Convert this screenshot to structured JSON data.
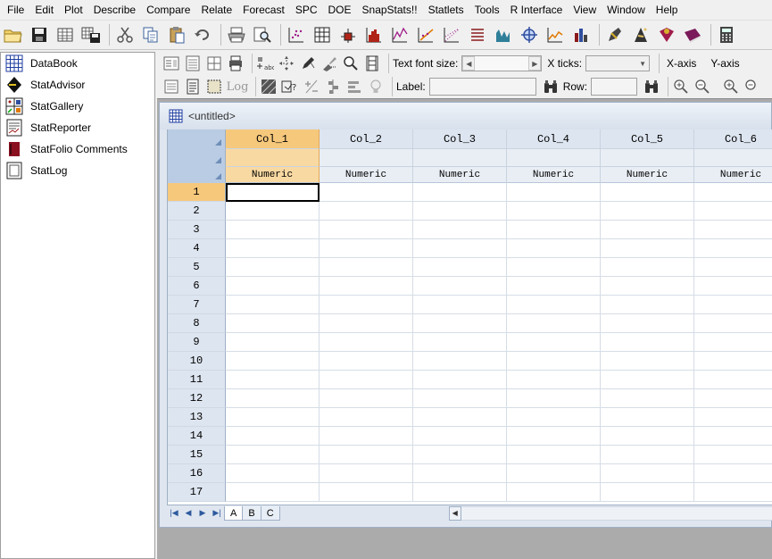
{
  "menu": [
    "File",
    "Edit",
    "Plot",
    "Describe",
    "Compare",
    "Relate",
    "Forecast",
    "SPC",
    "DOE",
    "SnapStats!!",
    "Statlets",
    "Tools",
    "R Interface",
    "View",
    "Window",
    "Help"
  ],
  "navigator": {
    "items": [
      {
        "label": "DataBook",
        "icon": "databook-grid-icon"
      },
      {
        "label": "StatAdvisor",
        "icon": "stat-advisor-icon"
      },
      {
        "label": "StatGallery",
        "icon": "stat-gallery-icon"
      },
      {
        "label": "StatReporter",
        "icon": "stat-reporter-icon"
      },
      {
        "label": "StatFolio Comments",
        "icon": "statfolio-comments-icon"
      },
      {
        "label": "StatLog",
        "icon": "stat-log-icon"
      }
    ]
  },
  "graphics_toolbar": {
    "text_font_size_label": "Text font size:",
    "x_ticks_label": "X ticks:",
    "x_axis_label": "X-axis",
    "y_axis_label": "Y-axis",
    "label_label": "Label:",
    "row_label": "Row:",
    "log_label": "Log"
  },
  "document": {
    "title": "<untitled>"
  },
  "datasheet": {
    "columns": [
      {
        "name": "Col_1",
        "type": "Numeric"
      },
      {
        "name": "Col_2",
        "type": "Numeric"
      },
      {
        "name": "Col_3",
        "type": "Numeric"
      },
      {
        "name": "Col_4",
        "type": "Numeric"
      },
      {
        "name": "Col_5",
        "type": "Numeric"
      },
      {
        "name": "Col_6",
        "type": "Numeric"
      }
    ],
    "rows": [
      "1",
      "2",
      "3",
      "4",
      "5",
      "6",
      "7",
      "8",
      "9",
      "10",
      "11",
      "12",
      "13",
      "14",
      "15",
      "16",
      "17"
    ],
    "sheets": [
      "A",
      "B",
      "C"
    ],
    "active_sheet": "A",
    "active_cell": {
      "row": "1",
      "column": "Col_1"
    }
  },
  "colors": {
    "selected_header": "#f6c87c",
    "header_blue": "#dde5f0",
    "corner_blue": "#b9cce3"
  }
}
